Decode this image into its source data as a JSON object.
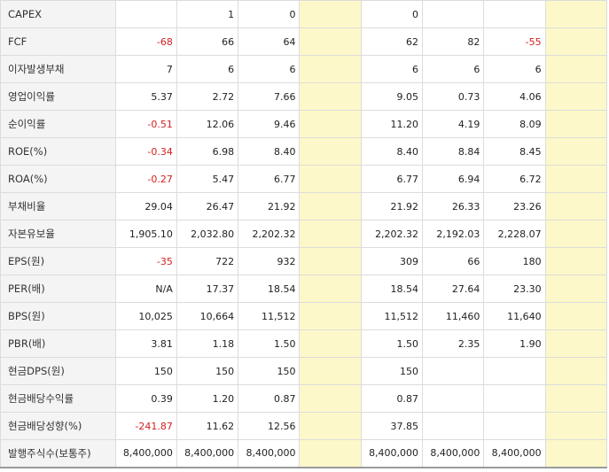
{
  "table": {
    "highlight_color": "#fdf8c9",
    "negative_color": "#d42020",
    "rows": [
      {
        "label": "CAPEX",
        "values": [
          "",
          "1",
          "0",
          "",
          "0",
          "",
          "",
          ""
        ]
      },
      {
        "label": "FCF",
        "values": [
          "-68",
          "66",
          "64",
          "",
          "62",
          "82",
          "-55",
          ""
        ]
      },
      {
        "label": "이자발생부채",
        "values": [
          "7",
          "6",
          "6",
          "",
          "6",
          "6",
          "6",
          ""
        ]
      },
      {
        "label": "영업이익률",
        "values": [
          "5.37",
          "2.72",
          "7.66",
          "",
          "9.05",
          "0.73",
          "4.06",
          ""
        ]
      },
      {
        "label": "순이익률",
        "values": [
          "-0.51",
          "12.06",
          "9.46",
          "",
          "11.20",
          "4.19",
          "8.09",
          ""
        ]
      },
      {
        "label": "ROE(%)",
        "values": [
          "-0.34",
          "6.98",
          "8.40",
          "",
          "8.40",
          "8.84",
          "8.45",
          ""
        ]
      },
      {
        "label": "ROA(%)",
        "values": [
          "-0.27",
          "5.47",
          "6.77",
          "",
          "6.77",
          "6.94",
          "6.72",
          ""
        ]
      },
      {
        "label": "부채비율",
        "values": [
          "29.04",
          "26.47",
          "21.92",
          "",
          "21.92",
          "26.33",
          "23.26",
          ""
        ]
      },
      {
        "label": "자본유보율",
        "values": [
          "1,905.10",
          "2,032.80",
          "2,202.32",
          "",
          "2,202.32",
          "2,192.03",
          "2,228.07",
          ""
        ]
      },
      {
        "label": "EPS(원)",
        "values": [
          "-35",
          "722",
          "932",
          "",
          "309",
          "66",
          "180",
          ""
        ]
      },
      {
        "label": "PER(배)",
        "values": [
          "N/A",
          "17.37",
          "18.54",
          "",
          "18.54",
          "27.64",
          "23.30",
          ""
        ]
      },
      {
        "label": "BPS(원)",
        "values": [
          "10,025",
          "10,664",
          "11,512",
          "",
          "11,512",
          "11,460",
          "11,640",
          ""
        ]
      },
      {
        "label": "PBR(배)",
        "values": [
          "3.81",
          "1.18",
          "1.50",
          "",
          "1.50",
          "2.35",
          "1.90",
          ""
        ]
      },
      {
        "label": "현금DPS(원)",
        "values": [
          "150",
          "150",
          "150",
          "",
          "150",
          "",
          "",
          ""
        ]
      },
      {
        "label": "현금배당수익률",
        "values": [
          "0.39",
          "1.20",
          "0.87",
          "",
          "0.87",
          "",
          "",
          ""
        ]
      },
      {
        "label": "현금배당성향(%)",
        "values": [
          "-241.87",
          "11.62",
          "12.56",
          "",
          "37.85",
          "",
          "",
          ""
        ]
      },
      {
        "label": "발행주식수(보통주)",
        "values": [
          "8,400,000",
          "8,400,000",
          "8,400,000",
          "",
          "8,400,000",
          "8,400,000",
          "8,400,000",
          ""
        ]
      }
    ]
  }
}
